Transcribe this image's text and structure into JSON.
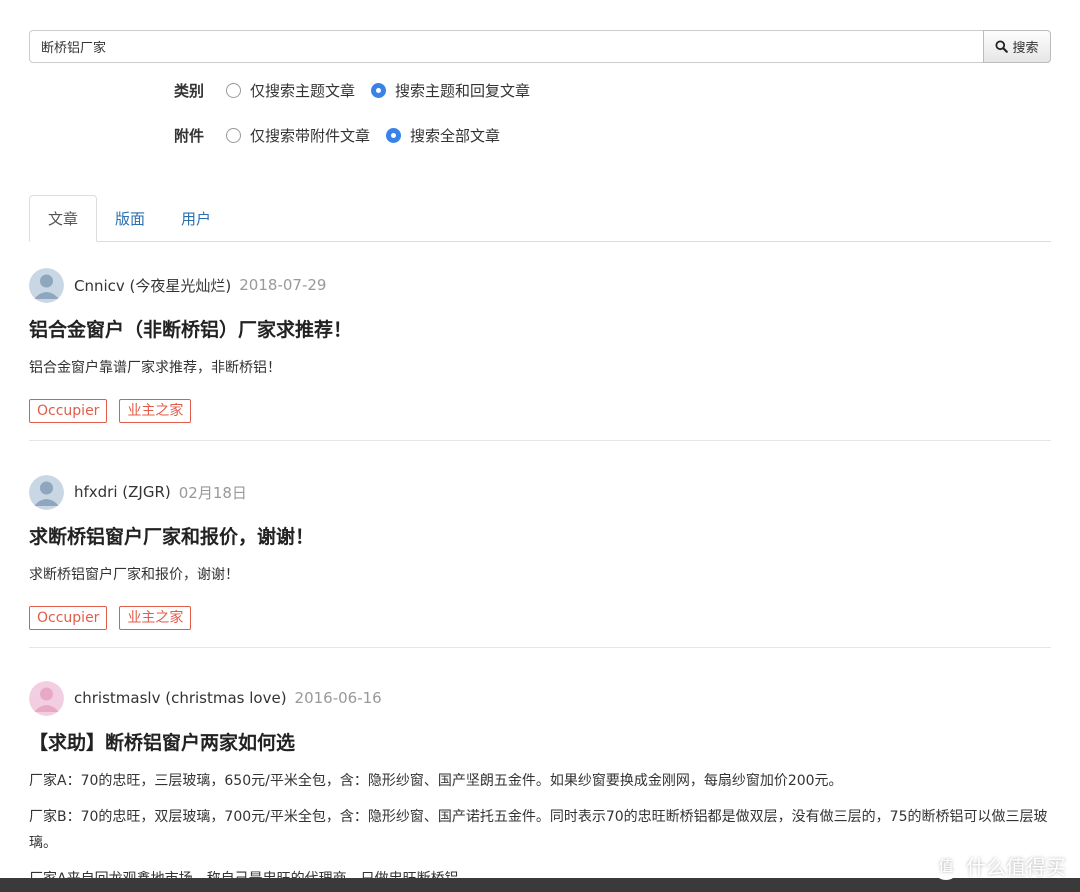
{
  "search": {
    "value": "断桥铝厂家",
    "button_label": "搜索"
  },
  "filters": {
    "category": {
      "label": "类别",
      "options": [
        "仅搜索主题文章",
        "搜索主题和回复文章"
      ],
      "selected_index": 1
    },
    "attachment": {
      "label": "附件",
      "options": [
        "仅搜索带附件文章",
        "搜索全部文章"
      ],
      "selected_index": 1
    }
  },
  "tabs": [
    "文章",
    "版面",
    "用户"
  ],
  "active_tab": "文章",
  "posts": [
    {
      "user": "Cnnicv (今夜星光灿烂)",
      "date": "2018-07-29",
      "title": "铝合金窗户（非断桥铝）厂家求推荐！",
      "summary": "铝合金窗户靠谱厂家求推荐，非断桥铝！",
      "tags": [
        "Occupier",
        "业主之家"
      ]
    },
    {
      "user": "hfxdri (ZJGR)",
      "date": "02月18日",
      "title": "求断桥铝窗户厂家和报价，谢谢！",
      "summary": "求断桥铝窗户厂家和报价，谢谢！",
      "tags": [
        "Occupier",
        "业主之家"
      ]
    },
    {
      "user": "christmaslv (christmas love)",
      "date": "2016-06-16",
      "title": "【求助】断桥铝窗户两家如何选",
      "paragraphs": [
        "厂家A：70的忠旺，三层玻璃，650元/平米全包，含：隐形纱窗、国产坚朗五金件。如果纱窗要换成金刚网，每扇纱窗加价200元。",
        "厂家B：70的忠旺，双层玻璃，700元/平米全包，含：隐形纱窗、国产诺托五金件。同时表示70的忠旺断桥铝都是做双层，没有做三层的，75的断桥铝可以做三层玻璃。",
        "厂家A来自回龙观鑫地市场，称自己是忠旺的代理商，只做忠旺断桥铝"
      ]
    }
  ],
  "watermark": "什么值得买",
  "colors": {
    "accent": "#3b82e8",
    "tag": "#e25c4a",
    "link": "#2a6fb0"
  }
}
